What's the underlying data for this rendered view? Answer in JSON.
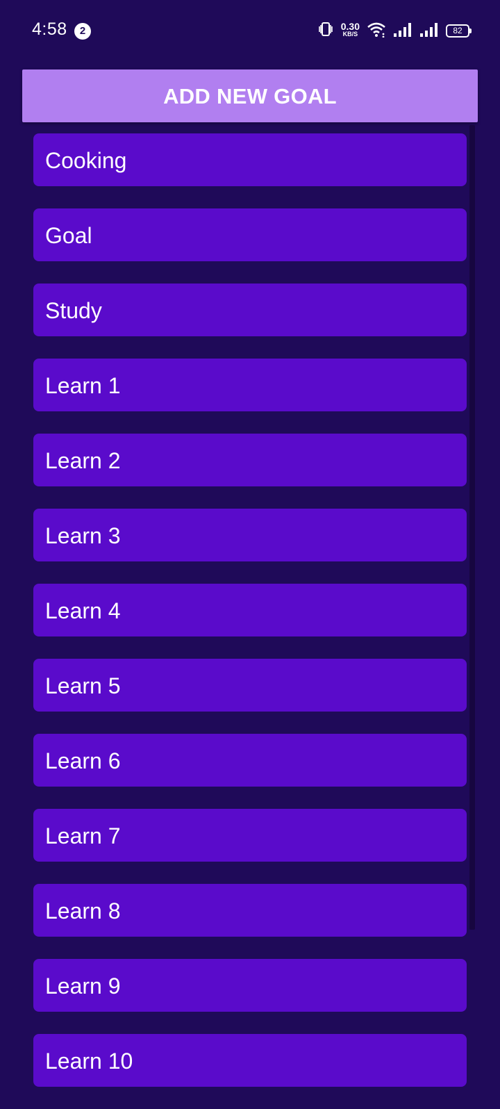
{
  "status_bar": {
    "time": "4:58",
    "notification_count": "2",
    "net_speed_value": "0.30",
    "net_speed_unit": "KB/S",
    "battery_level": "82",
    "icons": [
      "vibrate-icon",
      "wifi-icon",
      "signal-icon",
      "signal-icon",
      "battery-icon"
    ]
  },
  "add_goal": {
    "label": "ADD NEW GOAL"
  },
  "goals": [
    "Cooking",
    "Goal",
    "Study",
    "Learn 1",
    "Learn 2",
    "Learn 3",
    "Learn 4",
    "Learn 5",
    "Learn 6",
    "Learn 7",
    "Learn 8",
    "Learn 9",
    "Learn 10"
  ],
  "colors": {
    "background": "#1f0a59",
    "button": "#b17ff0",
    "list_item": "#5a0bcb",
    "text": "#ffffff"
  }
}
